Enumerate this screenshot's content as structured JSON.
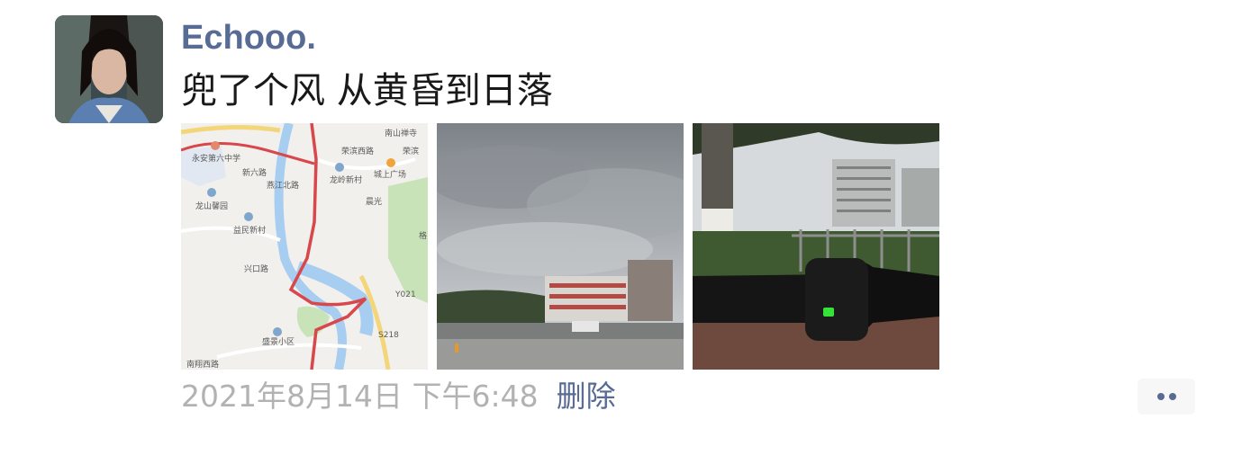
{
  "post": {
    "username": "Echooo.",
    "text": "兜了个风 从黄昏到日落",
    "timestamp": "2021年8月14日 下午6:48",
    "delete_label": "删除",
    "photos": [
      {
        "kind": "map"
      },
      {
        "kind": "cloudy-sky-school-building"
      },
      {
        "kind": "park-handlebar"
      }
    ],
    "map_labels": {
      "temple": "南山禅寺",
      "school": "永安第六中学",
      "road1": "荣滨西路",
      "road2": "荣滨",
      "road3": "新六路",
      "plaza": "城上广场",
      "village1": "龙岭新村",
      "garden": "龙山馨园",
      "village2": "益民新村",
      "road4": "燕江北路",
      "road5": "晨光",
      "road6": "兴口路",
      "road7": "格",
      "y021": "Y021",
      "s218": "S218",
      "district": "盛景小区",
      "road8": "南翔西路"
    }
  },
  "colors": {
    "username": "#576b95",
    "link": "#576b95",
    "timestamp": "#b2b2b2",
    "text": "#191919"
  }
}
